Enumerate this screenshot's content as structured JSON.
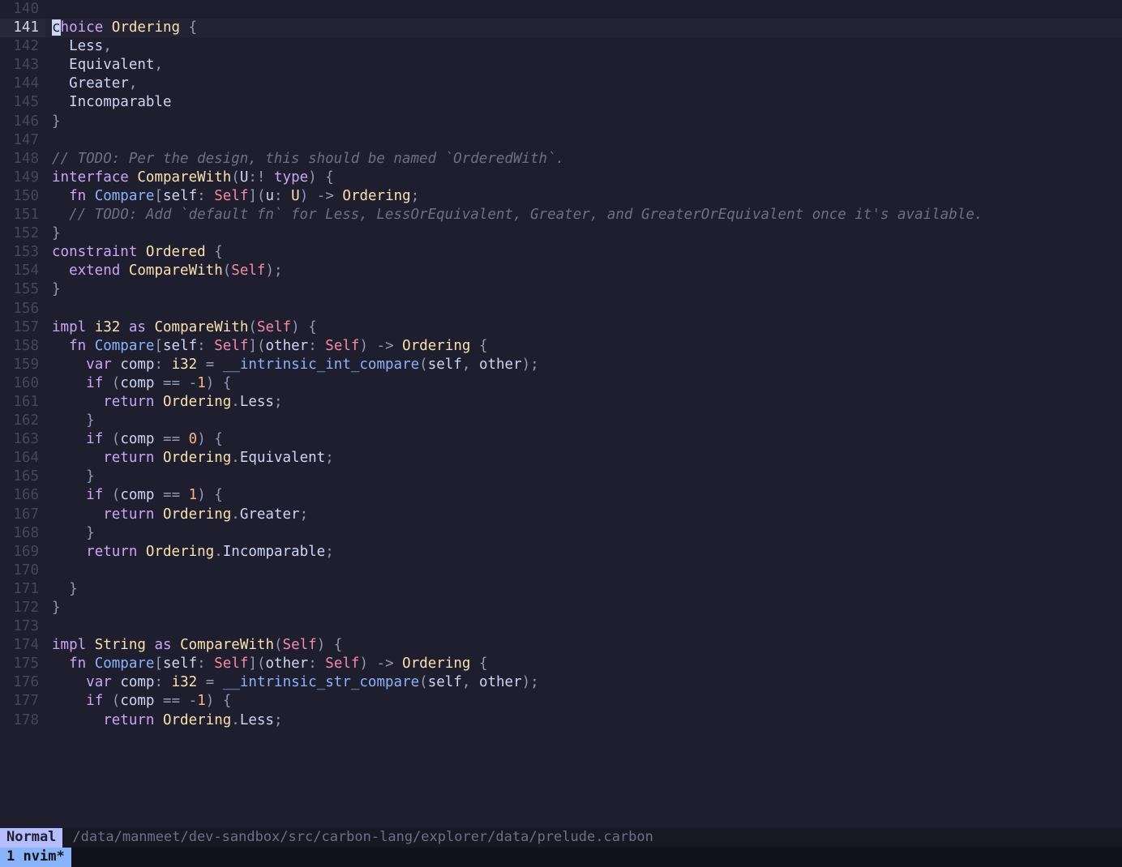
{
  "mode": "Normal",
  "filepath": "/data/manmeet/dev-sandbox/src/carbon-lang/explorer/data/prelude.carbon",
  "tmux": {
    "window_index": "1",
    "window_name": "nvim*"
  },
  "cursor": {
    "line": 141,
    "col": 0
  },
  "first_line": 140,
  "lines": [
    {
      "n": 140,
      "t": []
    },
    {
      "n": 141,
      "cursor": true,
      "t": [
        [
          "cur",
          "c"
        ],
        [
          "kw1",
          "hoice"
        ],
        [
          "sp",
          " "
        ],
        [
          "ty",
          "Ordering"
        ],
        [
          "sp",
          " "
        ],
        [
          "pn",
          "{"
        ]
      ]
    },
    {
      "n": 142,
      "t": [
        [
          "sp",
          "  "
        ],
        [
          "id",
          "Less"
        ],
        [
          "pn",
          ","
        ]
      ]
    },
    {
      "n": 143,
      "t": [
        [
          "sp",
          "  "
        ],
        [
          "id",
          "Equivalent"
        ],
        [
          "pn",
          ","
        ]
      ]
    },
    {
      "n": 144,
      "t": [
        [
          "sp",
          "  "
        ],
        [
          "id",
          "Greater"
        ],
        [
          "pn",
          ","
        ]
      ]
    },
    {
      "n": 145,
      "t": [
        [
          "sp",
          "  "
        ],
        [
          "id",
          "Incomparable"
        ]
      ]
    },
    {
      "n": 146,
      "t": [
        [
          "pn",
          "}"
        ]
      ]
    },
    {
      "n": 147,
      "t": []
    },
    {
      "n": 148,
      "t": [
        [
          "cm",
          "// TODO: Per the design, this should be named `OrderedWith`."
        ]
      ]
    },
    {
      "n": 149,
      "t": [
        [
          "kw1",
          "interface"
        ],
        [
          "sp",
          " "
        ],
        [
          "ty",
          "CompareWith"
        ],
        [
          "pn",
          "("
        ],
        [
          "id",
          "U"
        ],
        [
          "pn",
          ":!"
        ],
        [
          "sp",
          " "
        ],
        [
          "kw1",
          "type"
        ],
        [
          "pn",
          ")"
        ],
        [
          "sp",
          " "
        ],
        [
          "pn",
          "{"
        ]
      ]
    },
    {
      "n": 150,
      "t": [
        [
          "sp",
          "  "
        ],
        [
          "kw1",
          "fn"
        ],
        [
          "sp",
          " "
        ],
        [
          "fn",
          "Compare"
        ],
        [
          "pn",
          "["
        ],
        [
          "id",
          "self"
        ],
        [
          "pn",
          ":"
        ],
        [
          "sp",
          " "
        ],
        [
          "self",
          "Self"
        ],
        [
          "pn",
          "]("
        ],
        [
          "id",
          "u"
        ],
        [
          "pn",
          ":"
        ],
        [
          "sp",
          " "
        ],
        [
          "ty",
          "U"
        ],
        [
          "pn",
          ")"
        ],
        [
          "sp",
          " "
        ],
        [
          "pn",
          "->"
        ],
        [
          "sp",
          " "
        ],
        [
          "ty",
          "Ordering"
        ],
        [
          "pn",
          ";"
        ]
      ]
    },
    {
      "n": 151,
      "t": [
        [
          "sp",
          "  "
        ],
        [
          "cm",
          "// TODO: Add `default fn` for Less, LessOrEquivalent, Greater, and GreaterOrEquivalent once it's available."
        ]
      ]
    },
    {
      "n": 152,
      "t": [
        [
          "pn",
          "}"
        ]
      ]
    },
    {
      "n": 153,
      "t": [
        [
          "kw1",
          "constraint"
        ],
        [
          "sp",
          " "
        ],
        [
          "ty",
          "Ordered"
        ],
        [
          "sp",
          " "
        ],
        [
          "pn",
          "{"
        ]
      ]
    },
    {
      "n": 154,
      "t": [
        [
          "sp",
          "  "
        ],
        [
          "kw1",
          "extend"
        ],
        [
          "sp",
          " "
        ],
        [
          "ty",
          "CompareWith"
        ],
        [
          "pn",
          "("
        ],
        [
          "self",
          "Self"
        ],
        [
          "pn",
          ")"
        ],
        [
          "pn",
          ";"
        ]
      ]
    },
    {
      "n": 155,
      "t": [
        [
          "pn",
          "}"
        ]
      ]
    },
    {
      "n": 156,
      "t": []
    },
    {
      "n": 157,
      "t": [
        [
          "kw1",
          "impl"
        ],
        [
          "sp",
          " "
        ],
        [
          "ty",
          "i32"
        ],
        [
          "sp",
          " "
        ],
        [
          "kw1",
          "as"
        ],
        [
          "sp",
          " "
        ],
        [
          "ty",
          "CompareWith"
        ],
        [
          "pn",
          "("
        ],
        [
          "self",
          "Self"
        ],
        [
          "pn",
          ")"
        ],
        [
          "sp",
          " "
        ],
        [
          "pn",
          "{"
        ]
      ]
    },
    {
      "n": 158,
      "t": [
        [
          "sp",
          "  "
        ],
        [
          "kw1",
          "fn"
        ],
        [
          "sp",
          " "
        ],
        [
          "fn",
          "Compare"
        ],
        [
          "pn",
          "["
        ],
        [
          "id",
          "self"
        ],
        [
          "pn",
          ":"
        ],
        [
          "sp",
          " "
        ],
        [
          "self",
          "Self"
        ],
        [
          "pn",
          "]("
        ],
        [
          "id",
          "other"
        ],
        [
          "pn",
          ":"
        ],
        [
          "sp",
          " "
        ],
        [
          "self",
          "Self"
        ],
        [
          "pn",
          ")"
        ],
        [
          "sp",
          " "
        ],
        [
          "pn",
          "->"
        ],
        [
          "sp",
          " "
        ],
        [
          "ty",
          "Ordering"
        ],
        [
          "sp",
          " "
        ],
        [
          "pn",
          "{"
        ]
      ]
    },
    {
      "n": 159,
      "t": [
        [
          "sp",
          "    "
        ],
        [
          "kw1",
          "var"
        ],
        [
          "sp",
          " "
        ],
        [
          "id",
          "comp"
        ],
        [
          "pn",
          ":"
        ],
        [
          "sp",
          " "
        ],
        [
          "ty",
          "i32"
        ],
        [
          "sp",
          " "
        ],
        [
          "pn",
          "="
        ],
        [
          "sp",
          " "
        ],
        [
          "fn",
          "__intrinsic_int_compare"
        ],
        [
          "pn",
          "("
        ],
        [
          "id",
          "self"
        ],
        [
          "pn",
          ","
        ],
        [
          "sp",
          " "
        ],
        [
          "id",
          "other"
        ],
        [
          "pn",
          ")"
        ],
        [
          "pn",
          ";"
        ]
      ]
    },
    {
      "n": 160,
      "t": [
        [
          "sp",
          "    "
        ],
        [
          "kw1",
          "if"
        ],
        [
          "sp",
          " "
        ],
        [
          "pn",
          "("
        ],
        [
          "id",
          "comp"
        ],
        [
          "sp",
          " "
        ],
        [
          "pn",
          "=="
        ],
        [
          "sp",
          " "
        ],
        [
          "pn",
          "-"
        ],
        [
          "num",
          "1"
        ],
        [
          "pn",
          ")"
        ],
        [
          "sp",
          " "
        ],
        [
          "pn",
          "{"
        ]
      ]
    },
    {
      "n": 161,
      "t": [
        [
          "sp",
          "      "
        ],
        [
          "ret",
          "return"
        ],
        [
          "sp",
          " "
        ],
        [
          "ty",
          "Ordering"
        ],
        [
          "pn",
          "."
        ],
        [
          "id",
          "Less"
        ],
        [
          "pn",
          ";"
        ]
      ]
    },
    {
      "n": 162,
      "t": [
        [
          "sp",
          "    "
        ],
        [
          "pn",
          "}"
        ]
      ]
    },
    {
      "n": 163,
      "t": [
        [
          "sp",
          "    "
        ],
        [
          "kw1",
          "if"
        ],
        [
          "sp",
          " "
        ],
        [
          "pn",
          "("
        ],
        [
          "id",
          "comp"
        ],
        [
          "sp",
          " "
        ],
        [
          "pn",
          "=="
        ],
        [
          "sp",
          " "
        ],
        [
          "num",
          "0"
        ],
        [
          "pn",
          ")"
        ],
        [
          "sp",
          " "
        ],
        [
          "pn",
          "{"
        ]
      ]
    },
    {
      "n": 164,
      "t": [
        [
          "sp",
          "      "
        ],
        [
          "ret",
          "return"
        ],
        [
          "sp",
          " "
        ],
        [
          "ty",
          "Ordering"
        ],
        [
          "pn",
          "."
        ],
        [
          "id",
          "Equivalent"
        ],
        [
          "pn",
          ";"
        ]
      ]
    },
    {
      "n": 165,
      "t": [
        [
          "sp",
          "    "
        ],
        [
          "pn",
          "}"
        ]
      ]
    },
    {
      "n": 166,
      "t": [
        [
          "sp",
          "    "
        ],
        [
          "kw1",
          "if"
        ],
        [
          "sp",
          " "
        ],
        [
          "pn",
          "("
        ],
        [
          "id",
          "comp"
        ],
        [
          "sp",
          " "
        ],
        [
          "pn",
          "=="
        ],
        [
          "sp",
          " "
        ],
        [
          "num",
          "1"
        ],
        [
          "pn",
          ")"
        ],
        [
          "sp",
          " "
        ],
        [
          "pn",
          "{"
        ]
      ]
    },
    {
      "n": 167,
      "t": [
        [
          "sp",
          "      "
        ],
        [
          "ret",
          "return"
        ],
        [
          "sp",
          " "
        ],
        [
          "ty",
          "Ordering"
        ],
        [
          "pn",
          "."
        ],
        [
          "id",
          "Greater"
        ],
        [
          "pn",
          ";"
        ]
      ]
    },
    {
      "n": 168,
      "t": [
        [
          "sp",
          "    "
        ],
        [
          "pn",
          "}"
        ]
      ]
    },
    {
      "n": 169,
      "t": [
        [
          "sp",
          "    "
        ],
        [
          "ret",
          "return"
        ],
        [
          "sp",
          " "
        ],
        [
          "ty",
          "Ordering"
        ],
        [
          "pn",
          "."
        ],
        [
          "id",
          "Incomparable"
        ],
        [
          "pn",
          ";"
        ]
      ]
    },
    {
      "n": 170,
      "t": []
    },
    {
      "n": 171,
      "t": [
        [
          "sp",
          "  "
        ],
        [
          "pn",
          "}"
        ]
      ]
    },
    {
      "n": 172,
      "t": [
        [
          "pn",
          "}"
        ]
      ]
    },
    {
      "n": 173,
      "t": []
    },
    {
      "n": 174,
      "t": [
        [
          "kw1",
          "impl"
        ],
        [
          "sp",
          " "
        ],
        [
          "ty",
          "String"
        ],
        [
          "sp",
          " "
        ],
        [
          "kw1",
          "as"
        ],
        [
          "sp",
          " "
        ],
        [
          "ty",
          "CompareWith"
        ],
        [
          "pn",
          "("
        ],
        [
          "self",
          "Self"
        ],
        [
          "pn",
          ")"
        ],
        [
          "sp",
          " "
        ],
        [
          "pn",
          "{"
        ]
      ]
    },
    {
      "n": 175,
      "t": [
        [
          "sp",
          "  "
        ],
        [
          "kw1",
          "fn"
        ],
        [
          "sp",
          " "
        ],
        [
          "fn",
          "Compare"
        ],
        [
          "pn",
          "["
        ],
        [
          "id",
          "self"
        ],
        [
          "pn",
          ":"
        ],
        [
          "sp",
          " "
        ],
        [
          "self",
          "Self"
        ],
        [
          "pn",
          "]("
        ],
        [
          "id",
          "other"
        ],
        [
          "pn",
          ":"
        ],
        [
          "sp",
          " "
        ],
        [
          "self",
          "Self"
        ],
        [
          "pn",
          ")"
        ],
        [
          "sp",
          " "
        ],
        [
          "pn",
          "->"
        ],
        [
          "sp",
          " "
        ],
        [
          "ty",
          "Ordering"
        ],
        [
          "sp",
          " "
        ],
        [
          "pn",
          "{"
        ]
      ]
    },
    {
      "n": 176,
      "t": [
        [
          "sp",
          "    "
        ],
        [
          "kw1",
          "var"
        ],
        [
          "sp",
          " "
        ],
        [
          "id",
          "comp"
        ],
        [
          "pn",
          ":"
        ],
        [
          "sp",
          " "
        ],
        [
          "ty",
          "i32"
        ],
        [
          "sp",
          " "
        ],
        [
          "pn",
          "="
        ],
        [
          "sp",
          " "
        ],
        [
          "fn",
          "__intrinsic_str_compare"
        ],
        [
          "pn",
          "("
        ],
        [
          "id",
          "self"
        ],
        [
          "pn",
          ","
        ],
        [
          "sp",
          " "
        ],
        [
          "id",
          "other"
        ],
        [
          "pn",
          ")"
        ],
        [
          "pn",
          ";"
        ]
      ]
    },
    {
      "n": 177,
      "t": [
        [
          "sp",
          "    "
        ],
        [
          "kw1",
          "if"
        ],
        [
          "sp",
          " "
        ],
        [
          "pn",
          "("
        ],
        [
          "id",
          "comp"
        ],
        [
          "sp",
          " "
        ],
        [
          "pn",
          "=="
        ],
        [
          "sp",
          " "
        ],
        [
          "pn",
          "-"
        ],
        [
          "num",
          "1"
        ],
        [
          "pn",
          ")"
        ],
        [
          "sp",
          " "
        ],
        [
          "pn",
          "{"
        ]
      ]
    },
    {
      "n": 178,
      "t": [
        [
          "sp",
          "      "
        ],
        [
          "ret",
          "return"
        ],
        [
          "sp",
          " "
        ],
        [
          "ty",
          "Ordering"
        ],
        [
          "pn",
          "."
        ],
        [
          "id",
          "Less"
        ],
        [
          "pn",
          ";"
        ]
      ]
    }
  ]
}
